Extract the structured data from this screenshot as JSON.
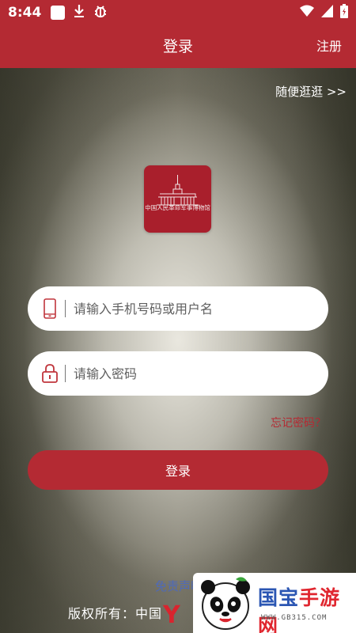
{
  "status_bar": {
    "time": "8:44",
    "left_icons": [
      "notification-square-icon",
      "download-icon",
      "bug-icon"
    ],
    "right_icons": [
      "wifi-icon",
      "signal-icon",
      "battery-icon"
    ]
  },
  "header": {
    "title": "登录",
    "register_label": "注册"
  },
  "browse_label": "随便逛逛 >>",
  "logo": {
    "text": "中国人民革命军事博物馆"
  },
  "form": {
    "username_placeholder": "请输入手机号码或用户名",
    "password_placeholder": "请输入密码",
    "forgot_label": "忘记密码？",
    "login_label": "登录"
  },
  "footer": {
    "disclaimer_label": "免责声明",
    "copyright_text": "版权所有：中国"
  },
  "watermark": {
    "left_glyph": "Y版",
    "brand_blue": "国宝",
    "brand_red": "手游网",
    "url": "WWW.GB315.COM"
  },
  "colors": {
    "primary_red": "#b42a33",
    "link_blue": "#4f6ab8"
  }
}
